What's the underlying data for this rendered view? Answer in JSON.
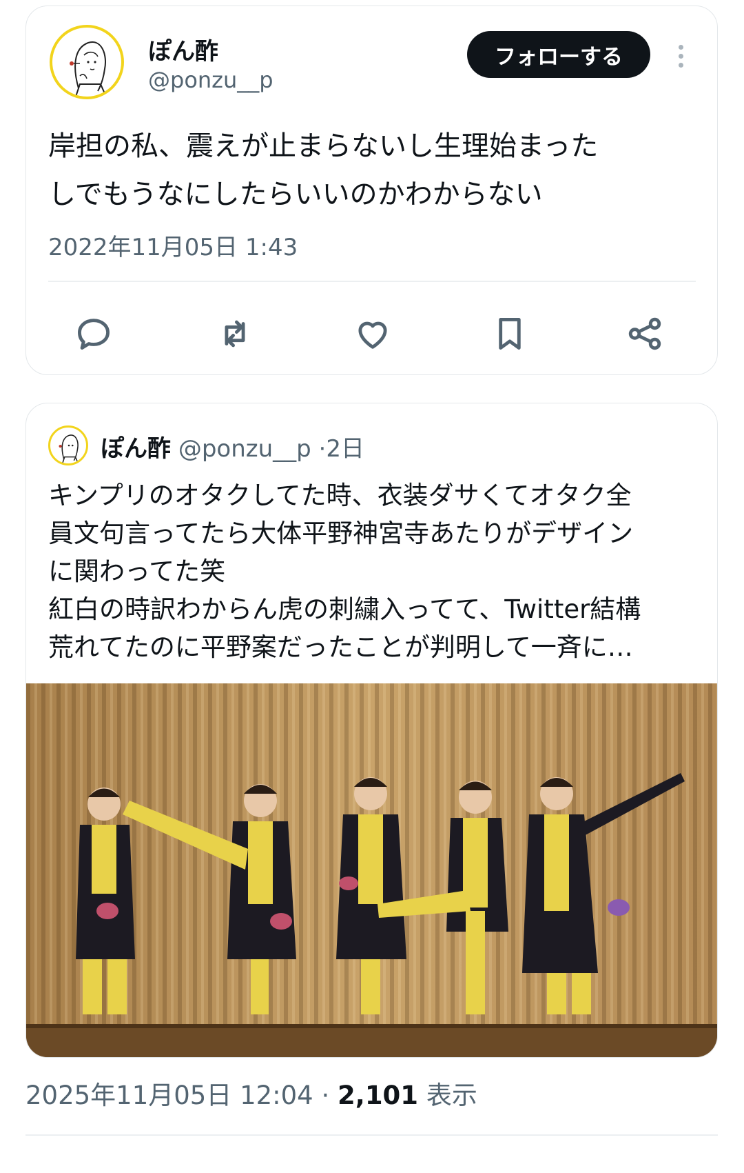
{
  "main_tweet": {
    "display_name": "ぽん酢",
    "handle": "@ponzu__p",
    "follow_label": "フォローする",
    "text": "岸担の私、震えが止まらないし生理始まった\nしでもうなにしたらいいのかわからない",
    "timestamp": "2022年11月05日 1:43",
    "actions": [
      "reply-icon",
      "retweet-icon",
      "like-icon",
      "bookmark-icon",
      "share-icon"
    ]
  },
  "quoted_tweet": {
    "display_name": "ぽん酢",
    "handle": "@ponzu__p",
    "age": "2日",
    "text": "キンプリのオタクしてた時、衣装ダサくてオタク全\n員文句言ってたら大体平野神宮寺あたりがデザイン\nに関わってた笑\n紅白の時訳わからん虎の刺繍入ってて、Twitter結構\n荒れてたのに平野案だったことが判明して一斉に…",
    "image_icon": "group-photo"
  },
  "footer": {
    "timestamp": "2025年11月05日 12:04",
    "separator": "·",
    "views_count": "2,101",
    "views_label": "表示"
  },
  "colors": {
    "avatar_ring": "#f2d41c",
    "text_primary": "#0f1419",
    "text_secondary": "#536471",
    "follow_bg": "#0f1419"
  }
}
